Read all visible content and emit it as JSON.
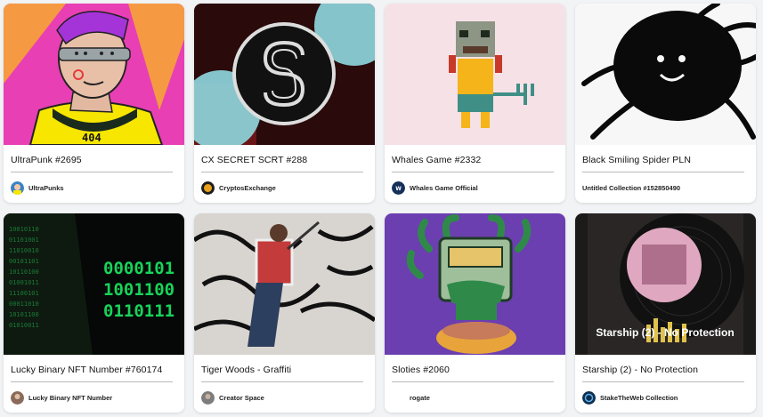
{
  "cards": [
    {
      "title": "UltraPunk #2695",
      "collection": "UltraPunks",
      "avatar_icon": "ultrapunks-avatar-icon",
      "art": "punk-portrait-image",
      "badge_text": "404"
    },
    {
      "title": "CX SECRET SCRT #288",
      "collection": "CryptosExchange",
      "avatar_icon": "cryptosexchange-avatar-icon",
      "art": "secret-logo-image"
    },
    {
      "title": "Whales Game #2332",
      "collection": "Whales Game Official",
      "avatar_icon": "whales-game-avatar-icon",
      "art": "pixel-whale-character-image"
    },
    {
      "title": "Black Smiling Spider PLN",
      "collection": "Untitled Collection #152850490",
      "avatar_icon": "",
      "art": "spider-drawing-image"
    },
    {
      "title": "Lucky Binary NFT Number #760174",
      "collection": "Lucky Binary NFT Number",
      "avatar_icon": "lucky-binary-avatar-icon",
      "art": "binary-nft-image",
      "binary_lines": [
        "0000101",
        "1001100",
        "0110111"
      ]
    },
    {
      "title": "Tiger Woods - Graffiti",
      "collection": "Creator Space",
      "avatar_icon": "creator-space-avatar-icon",
      "art": "graffiti-golfer-image"
    },
    {
      "title": "Sloties #2060",
      "collection": "rogate",
      "avatar_icon": "",
      "art": "slot-machine-snake-image"
    },
    {
      "title": "Starship (2) - No Protection",
      "collection": "StakeTheWeb Collection",
      "avatar_icon": "staketheweb-avatar-icon",
      "art": "vinyl-record-image",
      "art_caption": "Starship (2) - No Protection"
    }
  ],
  "colors": {
    "card_bg": "#ffffff",
    "page_bg": "#f2f3f5",
    "divider": "#b9b9b9",
    "punk_pink": "#e83fb4",
    "punk_yellow": "#f6e600",
    "secret_cyan": "#8fd8e0",
    "whale_bg": "#f6e1e6",
    "binary_green": "#18d35a",
    "sloties_purple": "#6b3fb0"
  }
}
